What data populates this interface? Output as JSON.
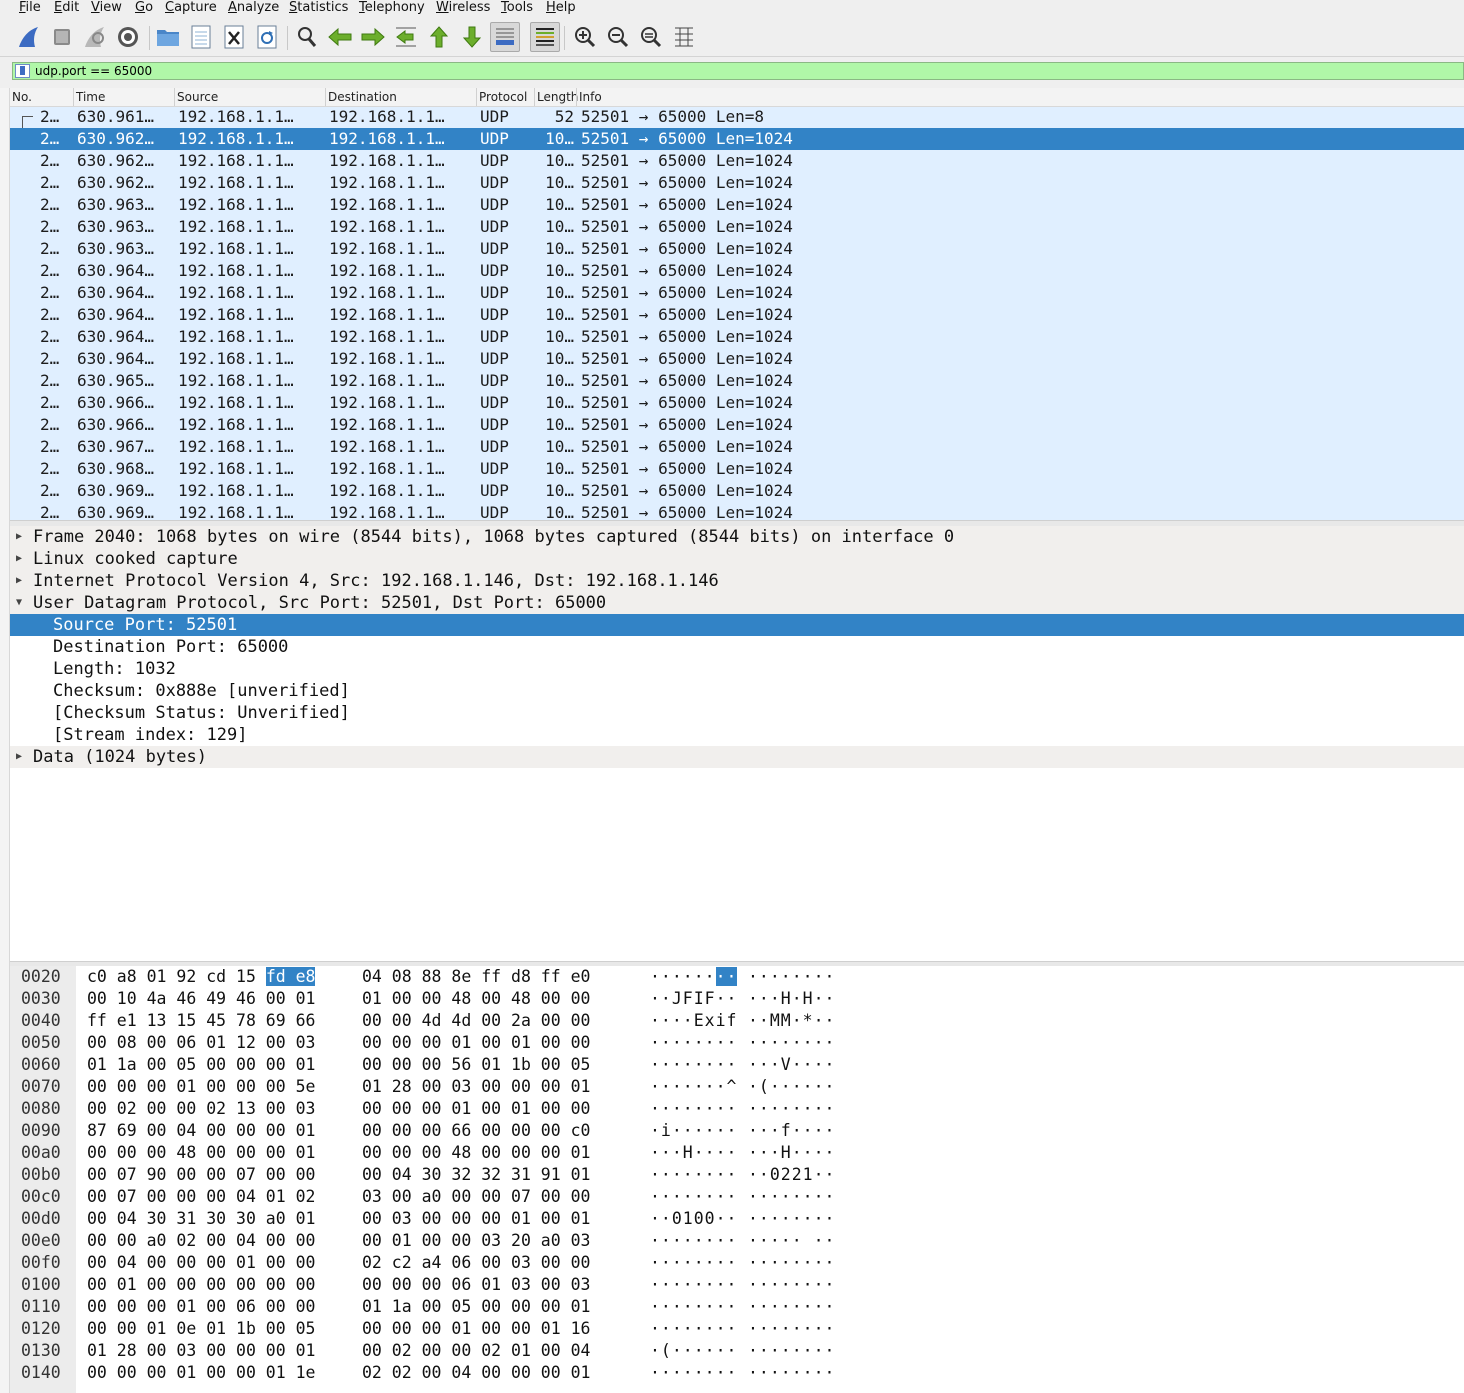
{
  "menu": [
    "File",
    "Edit",
    "View",
    "Go",
    "Capture",
    "Analyze",
    "Statistics",
    "Telephony",
    "Wireless",
    "Tools",
    "Help"
  ],
  "toolbar": {
    "icons": [
      "shark-fin-start-icon",
      "stop-icon",
      "shark-fin-restart-icon",
      "capture-options-icon",
      "open-folder-icon",
      "save-file-icon",
      "close-file-icon",
      "reload-icon",
      "find-icon",
      "back-arrow-icon",
      "forward-arrow-icon",
      "go-to-packet-icon",
      "first-packet-icon",
      "last-packet-icon",
      "auto-scroll-icon",
      "colorize-icon",
      "zoom-in-icon",
      "zoom-out-icon",
      "normal-size-icon",
      "resize-columns-icon"
    ]
  },
  "filter": {
    "value": "udp.port == 65000"
  },
  "columns": [
    "No.",
    "Time",
    "Source",
    "Destination",
    "Protocol",
    "Length",
    "Info"
  ],
  "packets": [
    {
      "no": "2…",
      "time": "630.961…",
      "src": "192.168.1.1…",
      "dst": "192.168.1.1…",
      "proto": "UDP",
      "len": "52",
      "info": "52501 → 65000 Len=8"
    },
    {
      "no": "2…",
      "time": "630.962…",
      "src": "192.168.1.1…",
      "dst": "192.168.1.1…",
      "proto": "UDP",
      "len": "10…",
      "info": "52501 → 65000 Len=1024"
    },
    {
      "no": "2…",
      "time": "630.962…",
      "src": "192.168.1.1…",
      "dst": "192.168.1.1…",
      "proto": "UDP",
      "len": "10…",
      "info": "52501 → 65000 Len=1024"
    },
    {
      "no": "2…",
      "time": "630.962…",
      "src": "192.168.1.1…",
      "dst": "192.168.1.1…",
      "proto": "UDP",
      "len": "10…",
      "info": "52501 → 65000 Len=1024"
    },
    {
      "no": "2…",
      "time": "630.963…",
      "src": "192.168.1.1…",
      "dst": "192.168.1.1…",
      "proto": "UDP",
      "len": "10…",
      "info": "52501 → 65000 Len=1024"
    },
    {
      "no": "2…",
      "time": "630.963…",
      "src": "192.168.1.1…",
      "dst": "192.168.1.1…",
      "proto": "UDP",
      "len": "10…",
      "info": "52501 → 65000 Len=1024"
    },
    {
      "no": "2…",
      "time": "630.963…",
      "src": "192.168.1.1…",
      "dst": "192.168.1.1…",
      "proto": "UDP",
      "len": "10…",
      "info": "52501 → 65000 Len=1024"
    },
    {
      "no": "2…",
      "time": "630.964…",
      "src": "192.168.1.1…",
      "dst": "192.168.1.1…",
      "proto": "UDP",
      "len": "10…",
      "info": "52501 → 65000 Len=1024"
    },
    {
      "no": "2…",
      "time": "630.964…",
      "src": "192.168.1.1…",
      "dst": "192.168.1.1…",
      "proto": "UDP",
      "len": "10…",
      "info": "52501 → 65000 Len=1024"
    },
    {
      "no": "2…",
      "time": "630.964…",
      "src": "192.168.1.1…",
      "dst": "192.168.1.1…",
      "proto": "UDP",
      "len": "10…",
      "info": "52501 → 65000 Len=1024"
    },
    {
      "no": "2…",
      "time": "630.964…",
      "src": "192.168.1.1…",
      "dst": "192.168.1.1…",
      "proto": "UDP",
      "len": "10…",
      "info": "52501 → 65000 Len=1024"
    },
    {
      "no": "2…",
      "time": "630.964…",
      "src": "192.168.1.1…",
      "dst": "192.168.1.1…",
      "proto": "UDP",
      "len": "10…",
      "info": "52501 → 65000 Len=1024"
    },
    {
      "no": "2…",
      "time": "630.965…",
      "src": "192.168.1.1…",
      "dst": "192.168.1.1…",
      "proto": "UDP",
      "len": "10…",
      "info": "52501 → 65000 Len=1024"
    },
    {
      "no": "2…",
      "time": "630.966…",
      "src": "192.168.1.1…",
      "dst": "192.168.1.1…",
      "proto": "UDP",
      "len": "10…",
      "info": "52501 → 65000 Len=1024"
    },
    {
      "no": "2…",
      "time": "630.966…",
      "src": "192.168.1.1…",
      "dst": "192.168.1.1…",
      "proto": "UDP",
      "len": "10…",
      "info": "52501 → 65000 Len=1024"
    },
    {
      "no": "2…",
      "time": "630.967…",
      "src": "192.168.1.1…",
      "dst": "192.168.1.1…",
      "proto": "UDP",
      "len": "10…",
      "info": "52501 → 65000 Len=1024"
    },
    {
      "no": "2…",
      "time": "630.968…",
      "src": "192.168.1.1…",
      "dst": "192.168.1.1…",
      "proto": "UDP",
      "len": "10…",
      "info": "52501 → 65000 Len=1024"
    },
    {
      "no": "2…",
      "time": "630.969…",
      "src": "192.168.1.1…",
      "dst": "192.168.1.1…",
      "proto": "UDP",
      "len": "10…",
      "info": "52501 → 65000 Len=1024"
    },
    {
      "no": "2…",
      "time": "630.969…",
      "src": "192.168.1.1…",
      "dst": "192.168.1.1…",
      "proto": "UDP",
      "len": "10…",
      "info": "52501 → 65000 Len=1024"
    }
  ],
  "selected_packet_index": 1,
  "details": [
    {
      "text": "Frame 2040: 1068 bytes on wire (8544 bits), 1068 bytes captured (8544 bits) on interface 0",
      "level": 0,
      "expandable": true,
      "expanded": false
    },
    {
      "text": "Linux cooked capture",
      "level": 0,
      "expandable": true,
      "expanded": false
    },
    {
      "text": "Internet Protocol Version 4, Src: 192.168.1.146, Dst: 192.168.1.146",
      "level": 0,
      "expandable": true,
      "expanded": false
    },
    {
      "text": "User Datagram Protocol, Src Port: 52501, Dst Port: 65000",
      "level": 0,
      "expandable": true,
      "expanded": true
    },
    {
      "text": "Source Port: 52501",
      "level": 1,
      "selected": true
    },
    {
      "text": "Destination Port: 65000",
      "level": 1
    },
    {
      "text": "Length: 1032",
      "level": 1
    },
    {
      "text": "Checksum: 0x888e [unverified]",
      "level": 1
    },
    {
      "text": "[Checksum Status: Unverified]",
      "level": 1
    },
    {
      "text": "[Stream index: 129]",
      "level": 1
    },
    {
      "text": "Data (1024 bytes)",
      "level": 0,
      "expandable": true,
      "expanded": false
    }
  ],
  "hex_rows": [
    {
      "off": "0020",
      "h1": "c0 a8 01 92 cd 15 ",
      "hsel": "fd e8",
      "h2": "04 08 88 8e ff d8 ff e0",
      "a1": "······",
      "asel": "··",
      "a2": "········"
    },
    {
      "off": "0030",
      "h1": "00 10 4a 46 49 46 00 01",
      "h2": "01 00 00 48 00 48 00 00",
      "a1": "··JFIF··",
      "a2": "···H·H··"
    },
    {
      "off": "0040",
      "h1": "ff e1 13 15 45 78 69 66",
      "h2": "00 00 4d 4d 00 2a 00 00",
      "a1": "····Exif",
      "a2": "··MM·*··"
    },
    {
      "off": "0050",
      "h1": "00 08 00 06 01 12 00 03",
      "h2": "00 00 00 01 00 01 00 00",
      "a1": "········",
      "a2": "········"
    },
    {
      "off": "0060",
      "h1": "01 1a 00 05 00 00 00 01",
      "h2": "00 00 00 56 01 1b 00 05",
      "a1": "········",
      "a2": "···V····"
    },
    {
      "off": "0070",
      "h1": "00 00 00 01 00 00 00 5e",
      "h2": "01 28 00 03 00 00 00 01",
      "a1": "·······^",
      "a2": "·(······"
    },
    {
      "off": "0080",
      "h1": "00 02 00 00 02 13 00 03",
      "h2": "00 00 00 01 00 01 00 00",
      "a1": "········",
      "a2": "········"
    },
    {
      "off": "0090",
      "h1": "87 69 00 04 00 00 00 01",
      "h2": "00 00 00 66 00 00 00 c0",
      "a1": "·i······",
      "a2": "···f····"
    },
    {
      "off": "00a0",
      "h1": "00 00 00 48 00 00 00 01",
      "h2": "00 00 00 48 00 00 00 01",
      "a1": "···H····",
      "a2": "···H····"
    },
    {
      "off": "00b0",
      "h1": "00 07 90 00 00 07 00 00",
      "h2": "00 04 30 32 32 31 91 01",
      "a1": "········",
      "a2": "··0221··"
    },
    {
      "off": "00c0",
      "h1": "00 07 00 00 00 04 01 02",
      "h2": "03 00 a0 00 00 07 00 00",
      "a1": "········",
      "a2": "········"
    },
    {
      "off": "00d0",
      "h1": "00 04 30 31 30 30 a0 01",
      "h2": "00 03 00 00 00 01 00 01",
      "a1": "··0100··",
      "a2": "········"
    },
    {
      "off": "00e0",
      "h1": "00 00 a0 02 00 04 00 00",
      "h2": "00 01 00 00 03 20 a0 03",
      "a1": "········",
      "a2": "····· ··"
    },
    {
      "off": "00f0",
      "h1": "00 04 00 00 00 01 00 00",
      "h2": "02 c2 a4 06 00 03 00 00",
      "a1": "········",
      "a2": "········"
    },
    {
      "off": "0100",
      "h1": "00 01 00 00 00 00 00 00",
      "h2": "00 00 00 06 01 03 00 03",
      "a1": "········",
      "a2": "········"
    },
    {
      "off": "0110",
      "h1": "00 00 00 01 00 06 00 00",
      "h2": "01 1a 00 05 00 00 00 01",
      "a1": "········",
      "a2": "········"
    },
    {
      "off": "0120",
      "h1": "00 00 01 0e 01 1b 00 05",
      "h2": "00 00 00 01 00 00 01 16",
      "a1": "········",
      "a2": "········"
    },
    {
      "off": "0130",
      "h1": "01 28 00 03 00 00 00 01",
      "h2": "00 02 00 00 02 01 00 04",
      "a1": "·(······",
      "a2": "········"
    },
    {
      "off": "0140",
      "h1": "00 00 00 01 00 00 01 1e",
      "h2": "02 02 00 04 00 00 00 01",
      "a1": "········",
      "a2": "········"
    }
  ],
  "colors": {
    "selection": "#3283c6",
    "udp_row": "#e0efff",
    "filter_ok": "#b0f7a8"
  }
}
